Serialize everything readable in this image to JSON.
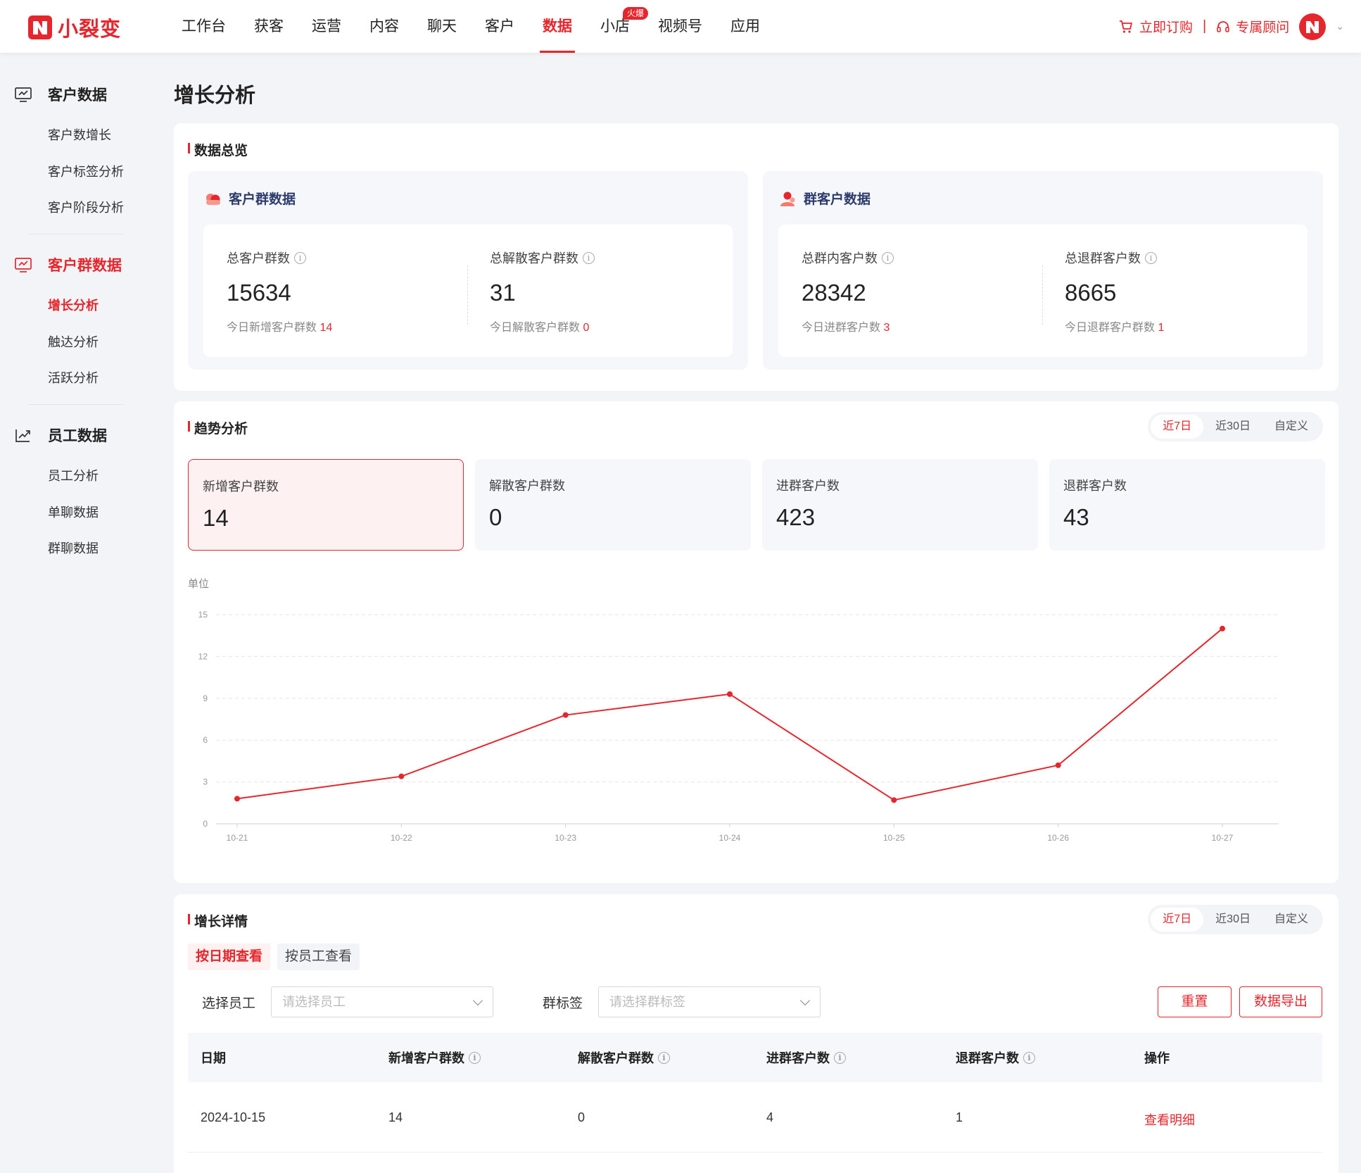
{
  "brand": {
    "name": "小裂变",
    "accent": "#e5262d"
  },
  "nav": {
    "items": [
      {
        "label": "工作台"
      },
      {
        "label": "获客"
      },
      {
        "label": "运营"
      },
      {
        "label": "内容"
      },
      {
        "label": "聊天"
      },
      {
        "label": "客户"
      },
      {
        "label": "数据"
      },
      {
        "label": "小店"
      },
      {
        "label": "视频号"
      },
      {
        "label": "应用"
      }
    ],
    "active": "数据",
    "badge": "火爆",
    "order_label": "立即订购",
    "consultant_label": "专属顾问"
  },
  "sidebar": {
    "groups": [
      {
        "label": "客户数据",
        "icon": "monitor-icon",
        "items": [
          "客户数增长",
          "客户标签分析",
          "客户阶段分析"
        ]
      },
      {
        "label": "客户群数据",
        "icon": "monitor-icon",
        "items": [
          "增长分析",
          "触达分析",
          "活跃分析"
        ]
      },
      {
        "label": "员工数据",
        "icon": "chart-up-icon",
        "items": [
          "员工分析",
          "单聊数据",
          "群聊数据"
        ]
      }
    ],
    "active_item": "增长分析"
  },
  "page_title": "增长分析",
  "overview": {
    "title": "数据总览",
    "panels": [
      {
        "title": "客户群数据",
        "stats": [
          {
            "label": "总客户群数",
            "value": "15634",
            "sub_label": "今日新增客户群数",
            "sub_value": "14"
          },
          {
            "label": "总解散客户群数",
            "value": "31",
            "sub_label": "今日解散客户群数",
            "sub_value": "0"
          }
        ]
      },
      {
        "title": "群客户数据",
        "stats": [
          {
            "label": "总群内客户数",
            "value": "28342",
            "sub_label": "今日进群客户数",
            "sub_value": "3"
          },
          {
            "label": "总退群客户数",
            "value": "8665",
            "sub_label": "今日退群客户群数",
            "sub_value": "1"
          }
        ]
      }
    ]
  },
  "trend": {
    "title": "趋势分析",
    "ranges": [
      "近7日",
      "近30日",
      "自定义"
    ],
    "active_range": "近7日",
    "metrics": [
      {
        "label": "新增客户群数",
        "value": "14"
      },
      {
        "label": "解散客户群数",
        "value": "0"
      },
      {
        "label": "进群客户数",
        "value": "423"
      },
      {
        "label": "退群客户数",
        "value": "43"
      }
    ],
    "active_metric": "新增客户群数",
    "unit_label": "单位"
  },
  "chart_data": {
    "type": "line",
    "x": [
      "10-21",
      "10-22",
      "10-23",
      "10-24",
      "10-25",
      "10-26",
      "10-27"
    ],
    "series": [
      {
        "values": [
          1.8,
          3.4,
          7.8,
          9.3,
          1.7,
          4.2,
          14.0
        ],
        "color": "#e5262d"
      }
    ],
    "ylim": [
      0,
      15
    ],
    "yticks": [
      0,
      3,
      6,
      9,
      12,
      15
    ],
    "ylabel": "单位",
    "grid": true
  },
  "detail": {
    "title": "增长详情",
    "ranges": [
      "近7日",
      "近30日",
      "自定义"
    ],
    "active_range": "近7日",
    "tabs": [
      "按日期查看",
      "按员工查看"
    ],
    "active_tab": "按日期查看",
    "filters": [
      {
        "label": "选择员工",
        "placeholder": "请选择员工"
      },
      {
        "label": "群标签",
        "placeholder": "请选择群标签"
      }
    ],
    "buttons": {
      "reset": "重置",
      "export": "数据导出"
    },
    "columns": [
      "日期",
      "新增客户群数",
      "解散客户群数",
      "进群客户数",
      "退群客户数",
      "操作"
    ],
    "rows": [
      {
        "date": "2024-10-15",
        "new_groups": "14",
        "dissolved": "0",
        "joined": "4",
        "left": "1",
        "action": "查看明细"
      }
    ]
  }
}
